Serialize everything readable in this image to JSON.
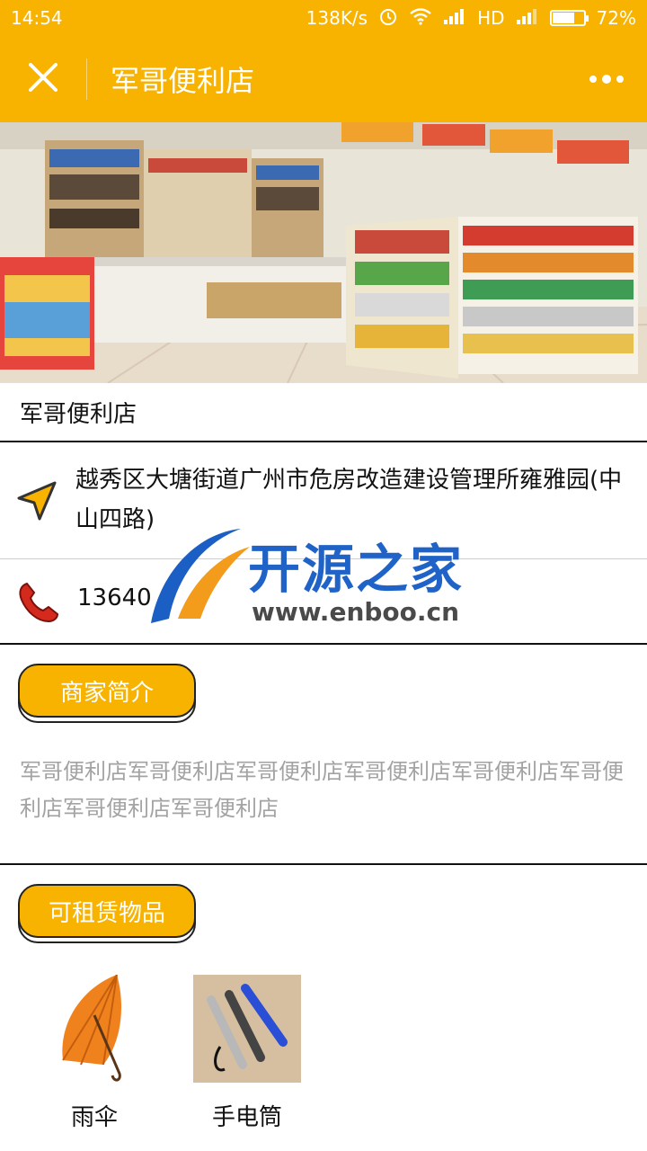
{
  "status_bar": {
    "time": "14:54",
    "network_speed": "138K/s",
    "network_type": "HD",
    "battery": "72%",
    "battery_level": 0.72
  },
  "nav": {
    "title": "军哥便利店",
    "close_icon": "close-icon",
    "more_icon": "more-icon"
  },
  "shop": {
    "name": "军哥便利店",
    "address": "越秀区大塘街道广州市危房改造建设管理所雍雅园(中山四路)",
    "phone": "13640"
  },
  "sections": {
    "intro_label": "商家简介",
    "intro_text": "军哥便利店军哥便利店军哥便利店军哥便利店军哥便利店军哥便利店军哥便利店军哥便利店",
    "rental_label": "可租赁物品"
  },
  "rental_items": [
    {
      "name": "雨伞",
      "icon": "umbrella-icon"
    },
    {
      "name": "手电筒",
      "icon": "flashlight-icon"
    }
  ],
  "watermark": {
    "text": "开源之家",
    "url": "www.enboo.cn"
  },
  "colors": {
    "accent": "#f8b300",
    "muted_text": "#a3a3a3"
  }
}
